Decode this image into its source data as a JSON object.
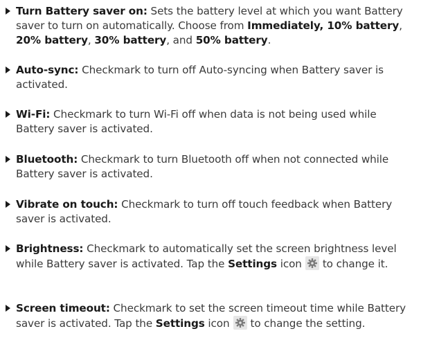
{
  "items": [
    {
      "term": "Turn Battery saver on:",
      "text1": " Sets the battery level at which you want Battery saver to turn on automatically. Choose from ",
      "opt1": "Immediately, 10% battery",
      "sep1": ", ",
      "opt2": "20% battery",
      "sep2": ", ",
      "opt3": "30% battery",
      "sep3": ", and ",
      "opt4": "50% battery",
      "end": "."
    },
    {
      "term": "Auto-sync:",
      "text": " Checkmark to turn off Auto-syncing when Battery saver is activated."
    },
    {
      "term": "Wi-Fi:",
      "text": " Checkmark to turn Wi-Fi off when data is not being used while Battery saver is activated."
    },
    {
      "term": "Bluetooth:",
      "text": " Checkmark to turn Bluetooth off when not connected while Battery saver is activated."
    },
    {
      "term": "Vibrate on touch:",
      "text": " Checkmark to turn off touch feedback when Battery saver is activated."
    },
    {
      "term": "Brightness:",
      "text1": " Checkmark to automatically set the screen brightness level while Battery saver is activated. Tap the ",
      "settings": "Settings",
      "text2": " icon",
      "text3": "to change it."
    },
    {
      "term": "Screen timeout:",
      "text1": " Checkmark to set the screen timeout time while Battery saver is activated. Tap the ",
      "settings": "Settings",
      "text2": " icon",
      "text3": "to change the setting."
    }
  ],
  "icons": {
    "bullet": "triangle-bullet-icon",
    "settings": "gear-icon"
  },
  "colors": {
    "text": "#3a3a3a",
    "emphasis": "#1a1a1a",
    "icon_background": "#e6e6e6",
    "icon_glyph": "#7a7a7a"
  }
}
